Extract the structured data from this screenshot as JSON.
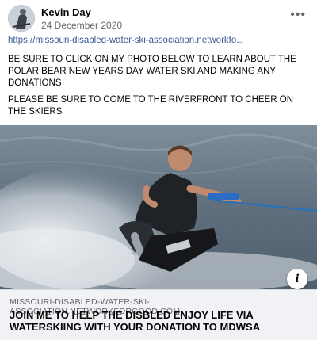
{
  "post": {
    "author": "Kevin Day",
    "date": "24 December 2020",
    "more_icon": "•••",
    "link_text": "https://missouri-disabled-water-ski-association.networkfo...",
    "body_paragraphs": [
      "BE SURE TO CLICK ON MY PHOTO BELOW TO LEARN ABOUT THE POLAR BEAR  NEW YEARS DAY WATER SKI  AND MAKING ANY DONATIONS",
      "PLEASE BE SURE TO COME TO THE RIVERFRONT TO CHEER ON THE SKIERS"
    ]
  },
  "link_preview": {
    "info_icon": "i",
    "domain": "MISSOURI-DISABLED-WATER-SKI-ASSOCIATION.NETWORKFORGOOD.COM",
    "headline": "JOIN ME TO HELP THE DISBLED ENJOY LIFE VIA WATERSKIING WITH YOUR DONATION TO MDWSA"
  },
  "colors": {
    "link": "#385898",
    "secondary_text": "#65676b",
    "footer_bg": "#f0f2f5"
  },
  "icons": {
    "more": "more-options-icon",
    "info": "info-icon"
  }
}
